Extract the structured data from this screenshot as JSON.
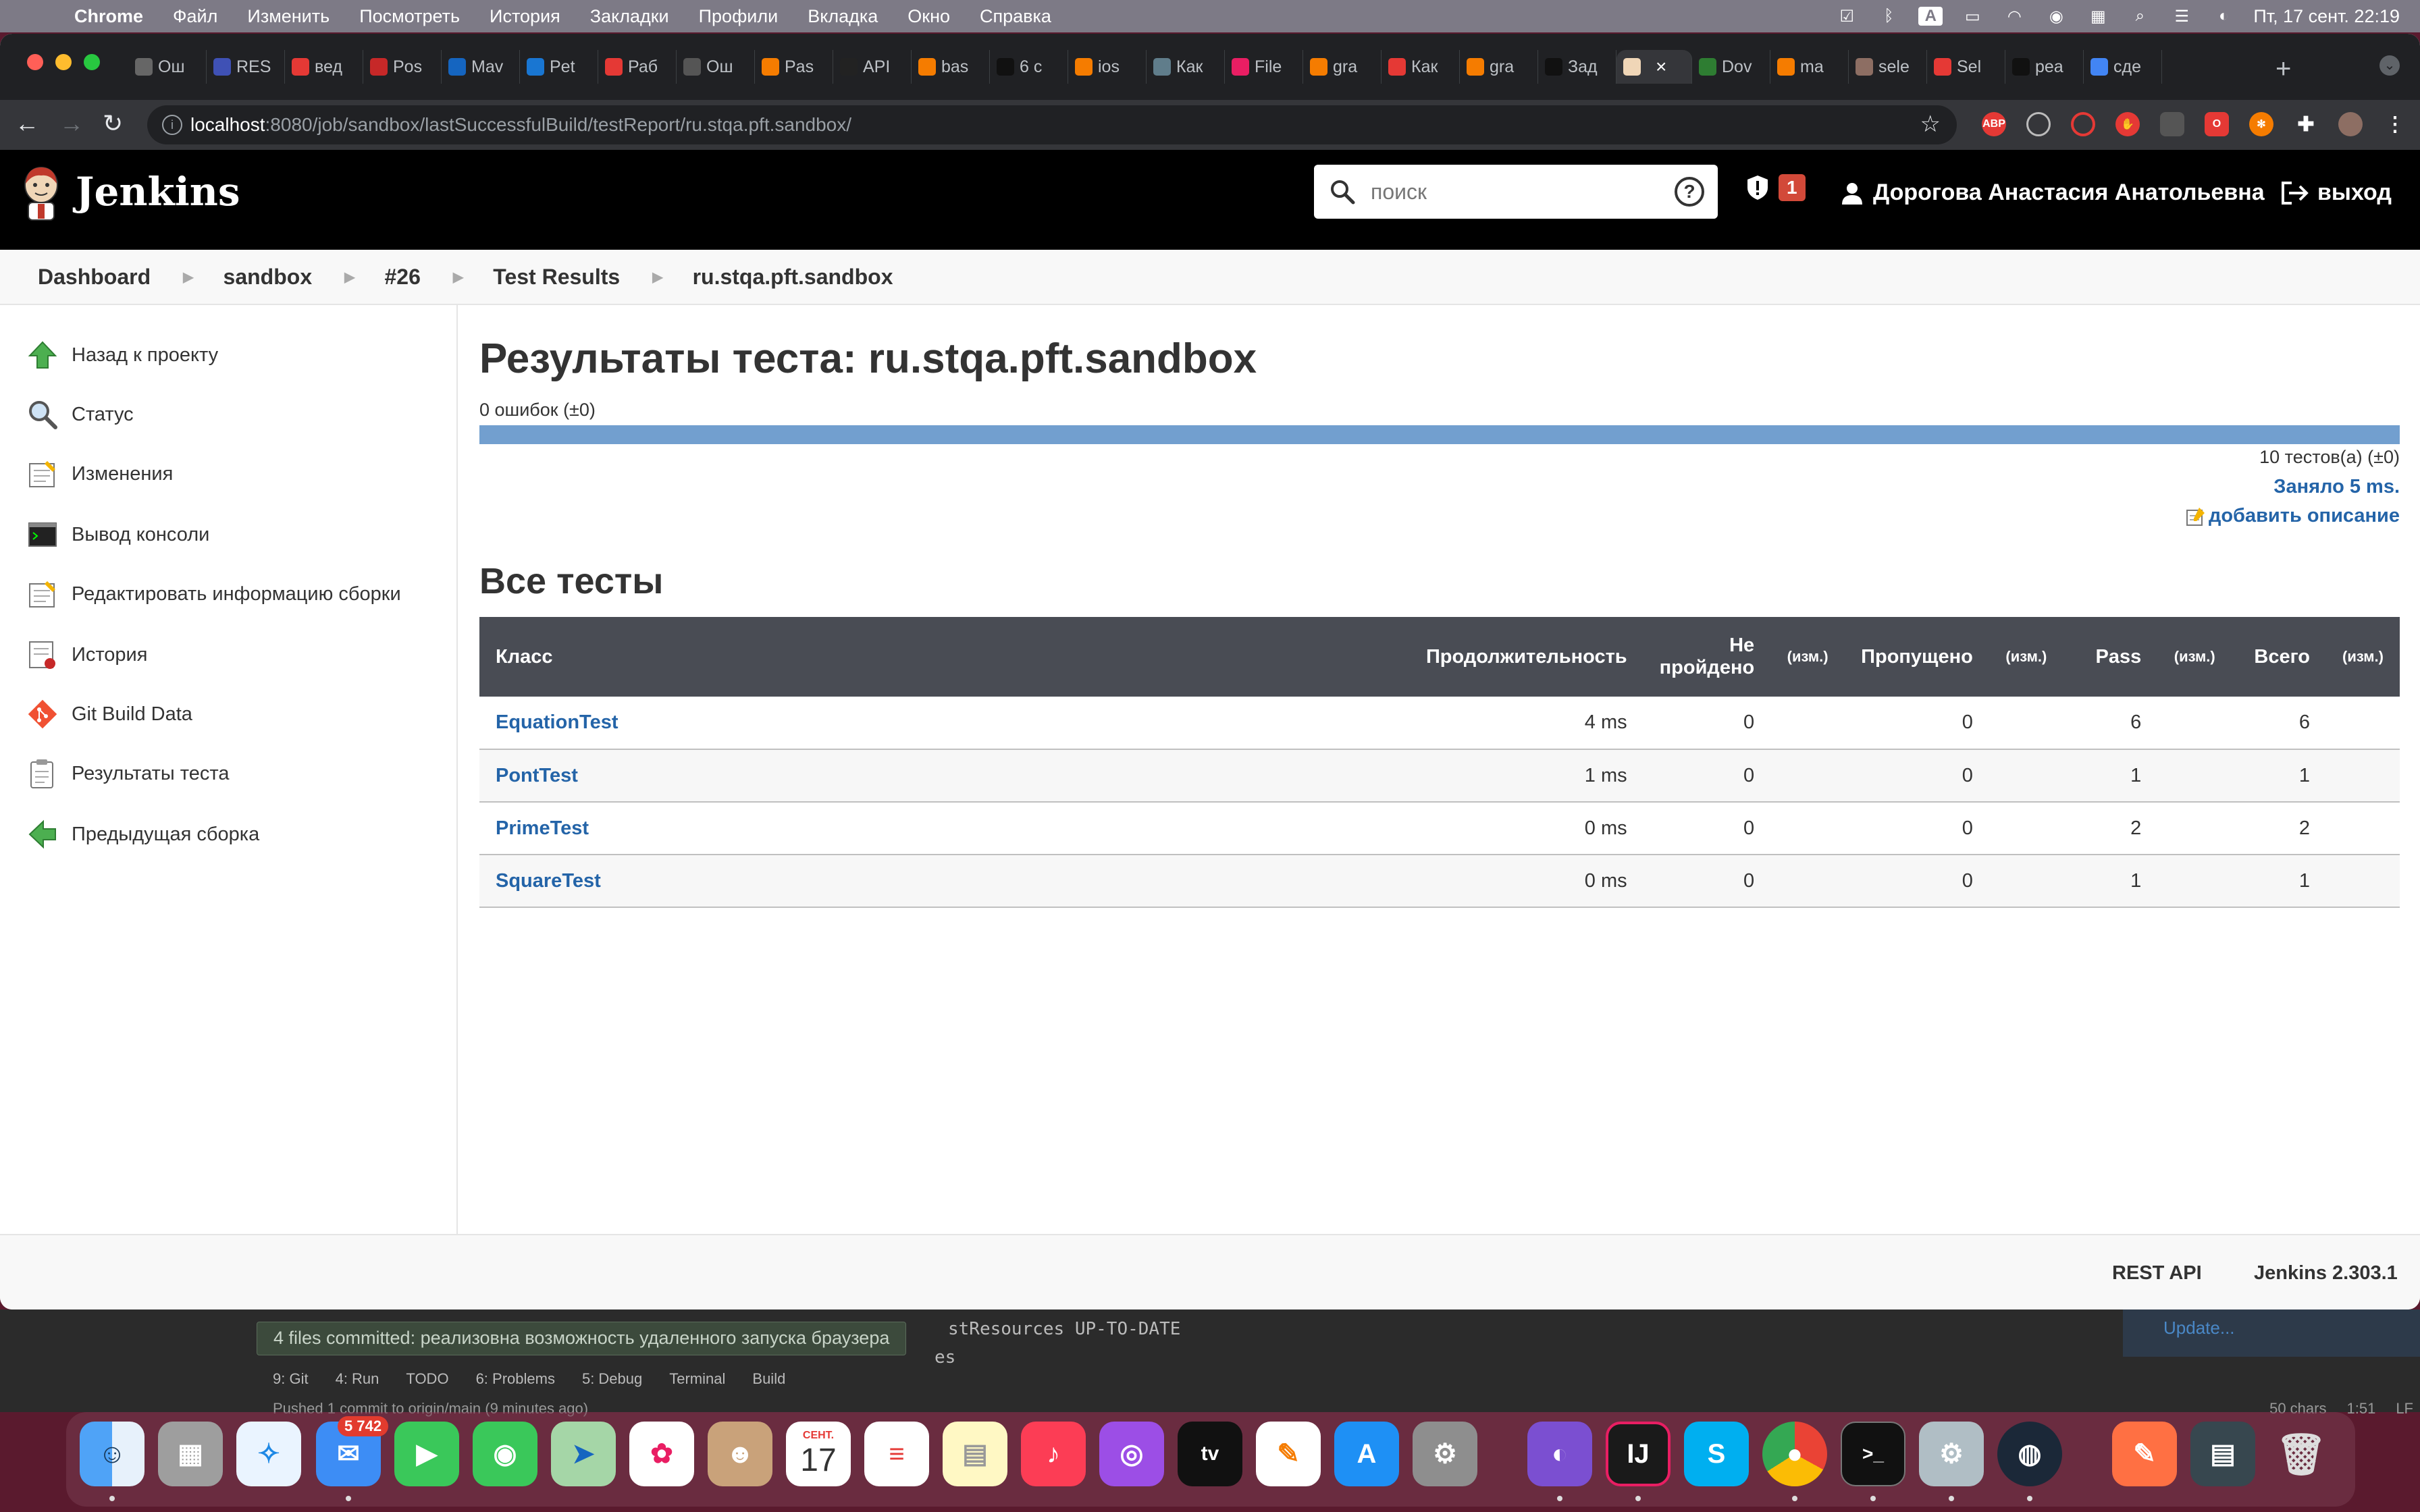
{
  "menubar": {
    "app": "Chrome",
    "items": [
      "Файл",
      "Изменить",
      "Посмотреть",
      "История",
      "Закладки",
      "Профили",
      "Вкладка",
      "Окно",
      "Справка"
    ],
    "clock": "Пт, 17 сент. 22:19"
  },
  "browser": {
    "tabs": [
      "Ош",
      "RES",
      "вед",
      "Pos",
      "Mav",
      "Pet",
      "Раб",
      "Ош",
      "Pas",
      "API",
      "bas",
      "6 с",
      "ios",
      "Как",
      "File",
      "gra",
      "Как",
      "gra",
      "Зад",
      "",
      "Dov",
      "ma",
      "sele",
      "Sel",
      "pea",
      "сде"
    ],
    "url_host": "localhost",
    "url_path": ":8080/job/sandbox/lastSuccessfulBuild/testReport/ru.stqa.pft.sandbox/"
  },
  "jenkins": {
    "title": "Jenkins",
    "search_placeholder": "поиск",
    "security_count": "1",
    "user": "Дорогова Анастасия Анатольевна",
    "logout": "выход"
  },
  "breadcrumbs": [
    "Dashboard",
    "sandbox",
    "#26",
    "Test Results",
    "ru.stqa.pft.sandbox"
  ],
  "sidebar": {
    "items": [
      {
        "label": "Назад к проекту",
        "icon": "up-arrow-icon"
      },
      {
        "label": "Статус",
        "icon": "magnifier-icon"
      },
      {
        "label": "Изменения",
        "icon": "notepad-icon"
      },
      {
        "label": "Вывод консоли",
        "icon": "terminal-icon"
      },
      {
        "label": "Редактировать информацию сборки",
        "icon": "notepad-icon"
      },
      {
        "label": "История",
        "icon": "notepad-icon"
      },
      {
        "label": "Git Build Data",
        "icon": "git-icon"
      },
      {
        "label": "Результаты теста",
        "icon": "clipboard-icon"
      },
      {
        "label": "Предыдущая сборка",
        "icon": "left-arrow-icon"
      }
    ]
  },
  "main": {
    "title": "Результаты теста: ru.stqa.pft.sandbox",
    "failures_summary": "0 ошибок (±0)",
    "pass_fraction": 1.0,
    "total_tests": "10 тестов(а) (±0)",
    "took": "Заняло 5 ms.",
    "add_description": "добавить описание",
    "all_tests_title": "Все тесты",
    "table": {
      "headers": {
        "class": "Класс",
        "duration": "Продолжительность",
        "failed": "Не пройдено",
        "diff": "(изм.)",
        "skipped": "Пропущено",
        "pass": "Pass",
        "total": "Всего"
      },
      "rows": [
        {
          "name": "EquationTest",
          "duration": "4 ms",
          "failed": "0",
          "skipped": "0",
          "pass": "6",
          "total": "6"
        },
        {
          "name": "PontTest",
          "duration": "1 ms",
          "failed": "0",
          "skipped": "0",
          "pass": "1",
          "total": "1"
        },
        {
          "name": "PrimeTest",
          "duration": "0 ms",
          "failed": "0",
          "skipped": "0",
          "pass": "2",
          "total": "2"
        },
        {
          "name": "SquareTest",
          "duration": "0 ms",
          "failed": "0",
          "skipped": "0",
          "pass": "1",
          "total": "1"
        }
      ]
    }
  },
  "footer": {
    "rest_api": "REST API",
    "version": "Jenkins 2.303.1"
  },
  "ide": {
    "balloon": "4 files committed: реализовна возможность удаленного запуска браузера",
    "console_line": "stResources UP-TO-DATE",
    "console_line2": "es",
    "update": "Update...",
    "tools": [
      "9: Git",
      "4: Run",
      "TODO",
      "6: Problems",
      "5: Debug",
      "Terminal",
      "Build"
    ],
    "status": "Pushed 1 commit to origin/main (9 minutes ago)",
    "status_right": [
      "50 chars",
      "1:51",
      "LF"
    ]
  },
  "dock": {
    "mail_badge": "5 742",
    "calendar_month": "СЕНТ.",
    "calendar_day": "17"
  },
  "colors": {
    "jenkins_header": "#000000",
    "link": "#2464a8",
    "progress_pass": "#729fcf",
    "table_header": "#494c54",
    "security_badge": "#d24939"
  }
}
